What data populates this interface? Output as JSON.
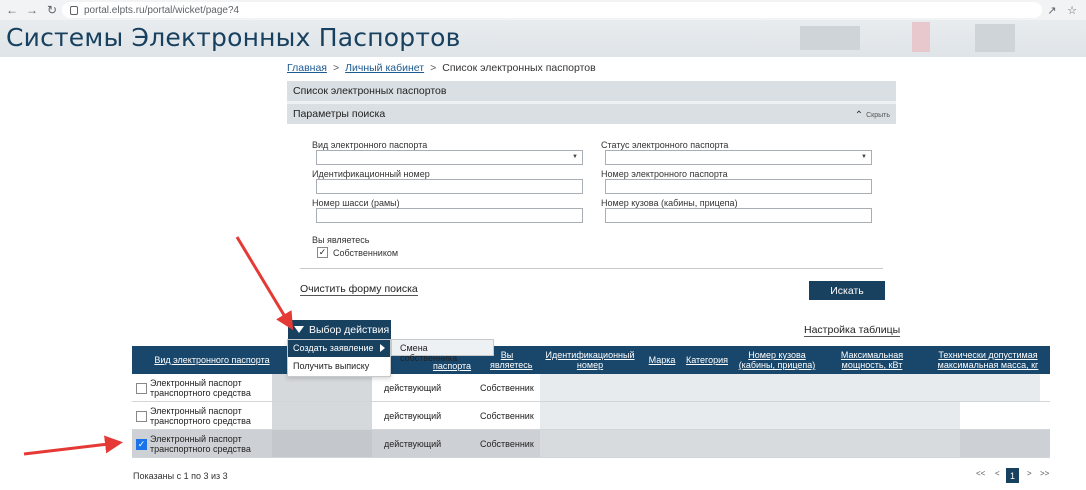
{
  "browser": {
    "url": "portal.elpts.ru/portal/wicket/page?4"
  },
  "header": {
    "title": "Системы Электронных Паспортов"
  },
  "breadcrumb": {
    "home": "Главная",
    "cabinet": "Личный кабинет",
    "current": "Список электронных паспортов",
    "separator": ">"
  },
  "list_panel": {
    "title": "Список электронных паспортов"
  },
  "search": {
    "title": "Параметры поиска",
    "hide_label": "Скрыть",
    "fields": {
      "passport_type": {
        "label": "Вид электронного паспорта",
        "value": ""
      },
      "passport_status": {
        "label": "Статус электронного паспорта",
        "value": ""
      },
      "id_number": {
        "label": "Идентификационный номер",
        "value": ""
      },
      "passport_number": {
        "label": "Номер электронного паспорта",
        "value": ""
      },
      "chassis_number": {
        "label": "Номер шасси (рамы)",
        "value": ""
      },
      "body_number": {
        "label": "Номер кузова (кабины, прицепа)",
        "value": ""
      }
    },
    "you_are_label": "Вы являетесь",
    "owner_label": "Собственником",
    "owner_checked": true,
    "clear_label": "Очистить форму поиска",
    "search_button": "Искать"
  },
  "actions": {
    "button_label": "Выбор действия",
    "menu": [
      {
        "label": "Создать заявление",
        "has_submenu": true
      },
      {
        "label": "Получить выписку",
        "has_submenu": false
      }
    ],
    "submenu": [
      "Смена собственника"
    ],
    "table_settings": "Настройка таблицы"
  },
  "table": {
    "headers": [
      "Вид электронного паспорта",
      "паспорта",
      "Вы являетесь",
      "Идентификационный номер",
      "Марка",
      "Категория",
      "Номер кузова (кабины, прицепа)",
      "Максимальная мощность, кВт",
      "Технически допустимая максимальная масса, кг"
    ],
    "rows": [
      {
        "type": "Электронный паспорт транспортного средства",
        "status": "действующий",
        "role": "Собственник",
        "checked": false
      },
      {
        "type": "Электронный паспорт транспортного средства",
        "status": "действующий",
        "role": "Собственник",
        "checked": false
      },
      {
        "type": "Электронный паспорт транспортного средства",
        "status": "действующий",
        "role": "Собственник",
        "checked": true
      }
    ]
  },
  "footer": {
    "shown_text": "Показаны с 1 по 3 из 3",
    "pager": {
      "first": "<<",
      "prev": "<",
      "current": "1",
      "next": ">",
      "last": ">>"
    }
  },
  "colors": {
    "brand_dark": "#18405f",
    "table_header": "#19476b",
    "annotation_red": "#e53935"
  }
}
